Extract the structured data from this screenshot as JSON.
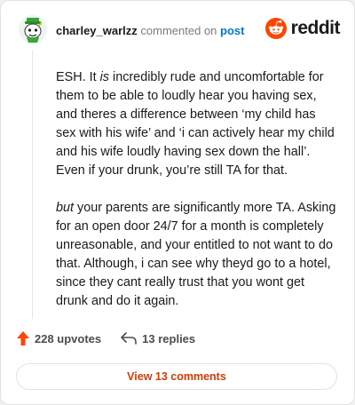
{
  "comment": {
    "username": "charley_warlzz",
    "commented_on_text": "commented on",
    "post_link": "post",
    "paragraphs": [
      {
        "emphasis_lead": "",
        "text_before": "ESH. It ",
        "emphasis": "is",
        "text_after": " incredibly rude and uncomfortable for them to be able to loudly hear you having sex, and theres a difference between ‘my child has sex with his wife’ and ‘i can actively hear my child and his wife loudly having sex down the hall’. Even if your drunk, you’re still TA for that."
      },
      {
        "emphasis_lead": "but",
        "text_before": "",
        "emphasis": "",
        "text_after": " your parents are significantly more TA. Asking for an open door 24/7 for a month is completely unreasonable, and your entitled to not want to do that. Although, i can see why theyd go to a hotel, since they cant really trust that you wont get drunk and do it again."
      }
    ]
  },
  "brand": {
    "wordmark": "reddit",
    "icon": "reddit-snoo-icon",
    "color": "#ff4500"
  },
  "actions": {
    "upvotes_label": "228 upvotes",
    "upvote_icon": "upvote-arrow-icon",
    "replies_label": "13 replies",
    "reply_icon": "reply-arrow-icon"
  },
  "footer": {
    "view_comments_label": "View 13 comments"
  },
  "colors": {
    "accent": "#d93a00",
    "upvote": "#ff4500",
    "link": "#0079d3"
  }
}
